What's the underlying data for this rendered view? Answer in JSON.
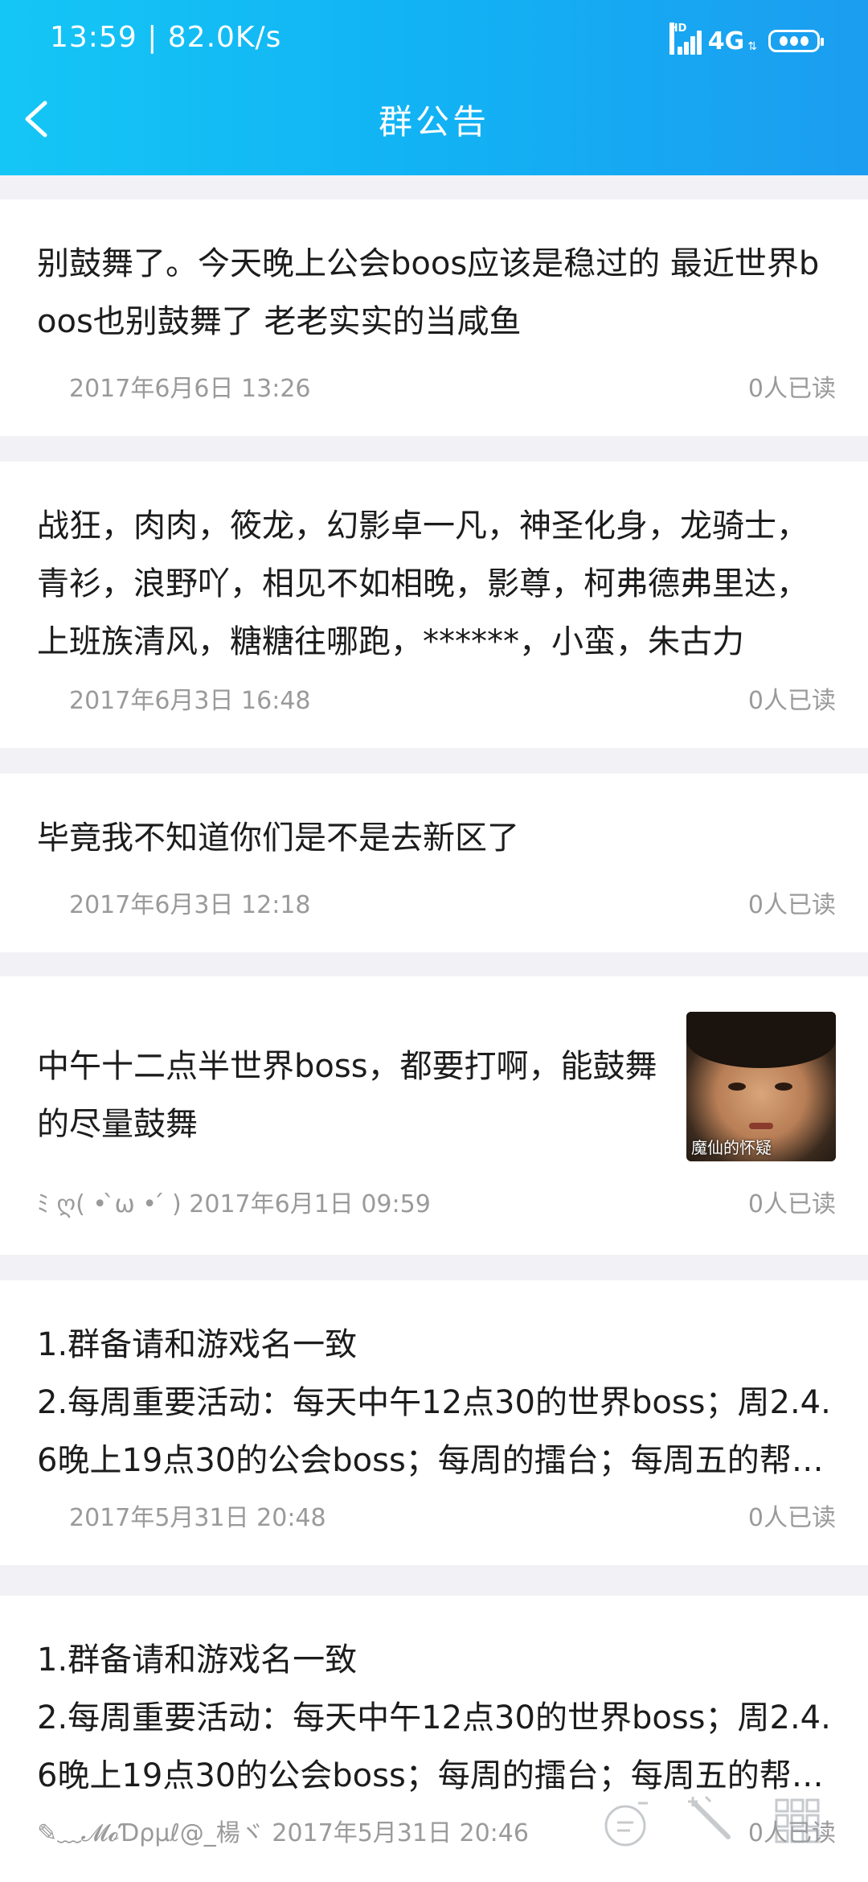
{
  "status_bar": {
    "time": "13:59",
    "net_speed": "82.0K/s",
    "hd": "HD",
    "network": "4G"
  },
  "header": {
    "title": "群公告"
  },
  "announcements": [
    {
      "text": "别鼓舞了。今天晚上公会boos应该是稳过的 最近世界boos也别鼓舞了 老老实实的当咸鱼",
      "author": "",
      "date": "2017年6月6日 13:26",
      "reads": "0人已读"
    },
    {
      "text": "战狂，肉肉，筱龙，幻影卓一凡，神圣化身，龙骑士，青衫，浪野吖，相见不如相晚，影尊，柯弗德弗里达，上班族清风，糖糖往哪跑，******，小蛮，朱古力",
      "author": "",
      "date": "2017年6月3日 16:48",
      "reads": "0人已读"
    },
    {
      "text": "毕竟我不知道你们是不是去新区了",
      "author": "",
      "date": "2017年6月3日 12:18",
      "reads": "0人已读"
    },
    {
      "text": "中午十二点半世界boss，都要打啊，能鼓舞的尽量鼓舞",
      "author": "ﾐ ღ( • ̀ω • ́ )",
      "date": "2017年6月1日 09:59",
      "reads": "0人已读",
      "image_caption": "魔仙的怀疑"
    },
    {
      "text": "1.群备请和游戏名一致\n2.每周重要活动：每天中午12点30的世界boss；周2.4.6晚上19点30的公会boss；每周的擂台；每周五的帮会战",
      "author": "",
      "date": "2017年5月31日 20:48",
      "reads": "0人已读"
    },
    {
      "text": "1.群备请和游戏名一致\n2.每周重要活动：每天中午12点30的世界boss；周2.4.6晚上19点30的公会boss；每周的擂台；每周五的帮会战",
      "author": "✎﹏𝓜𝓸Ɗρµℓ@_楊ヾ",
      "date": "2017年5月31日 20:46",
      "reads": "0人已读"
    }
  ]
}
